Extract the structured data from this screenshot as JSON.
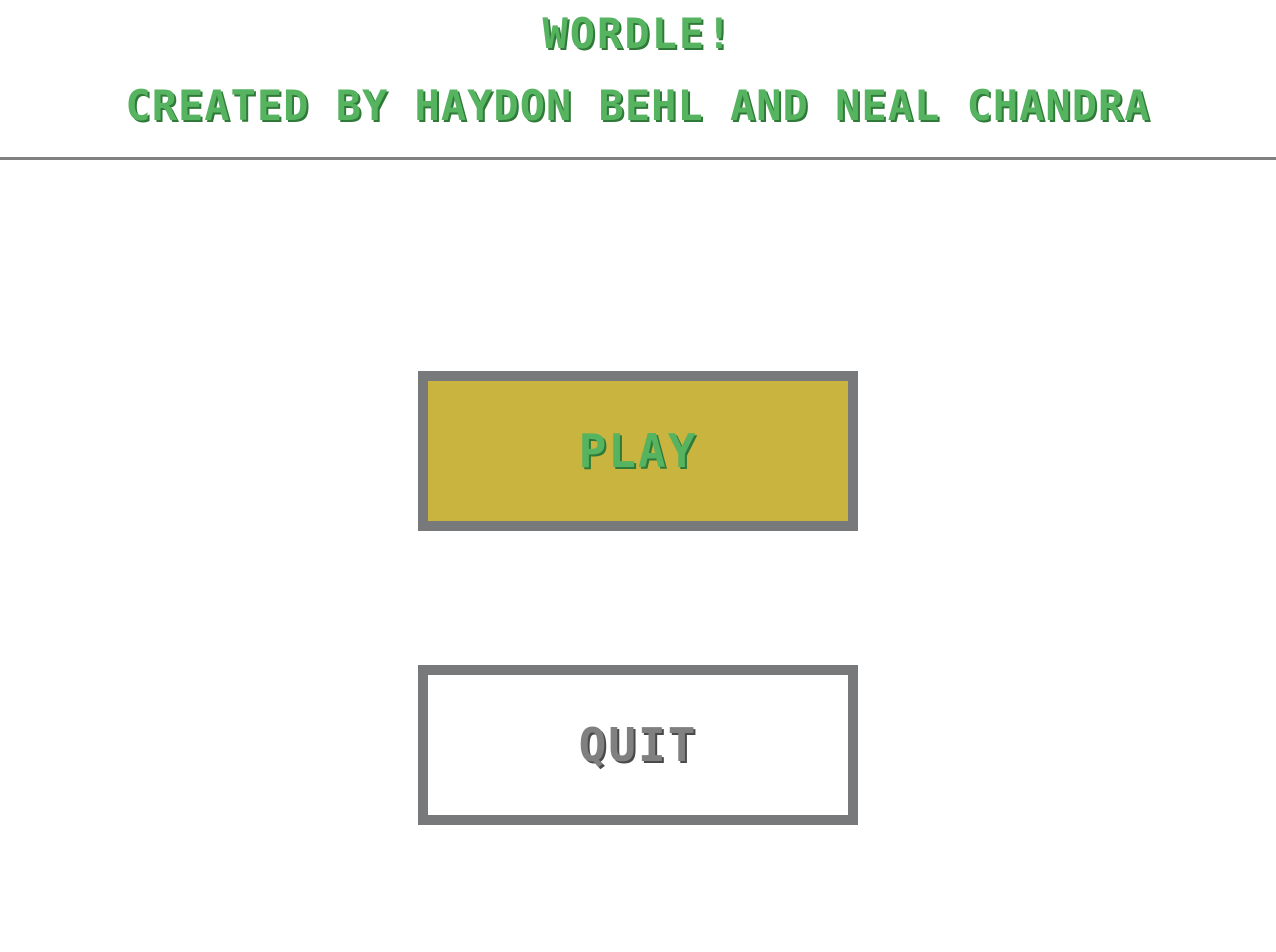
{
  "header": {
    "title": "WORDLE!",
    "subtitle": "CREATED BY HAYDON BEHL AND NEAL CHANDRA"
  },
  "menu": {
    "play_label": "PLAY",
    "quit_label": "QUIT"
  },
  "colors": {
    "text_green": "#56b35f",
    "play_bg": "#c9b440",
    "button_border": "#77797b",
    "quit_text": "#808080",
    "divider": "#808080",
    "background": "#ffffff"
  }
}
